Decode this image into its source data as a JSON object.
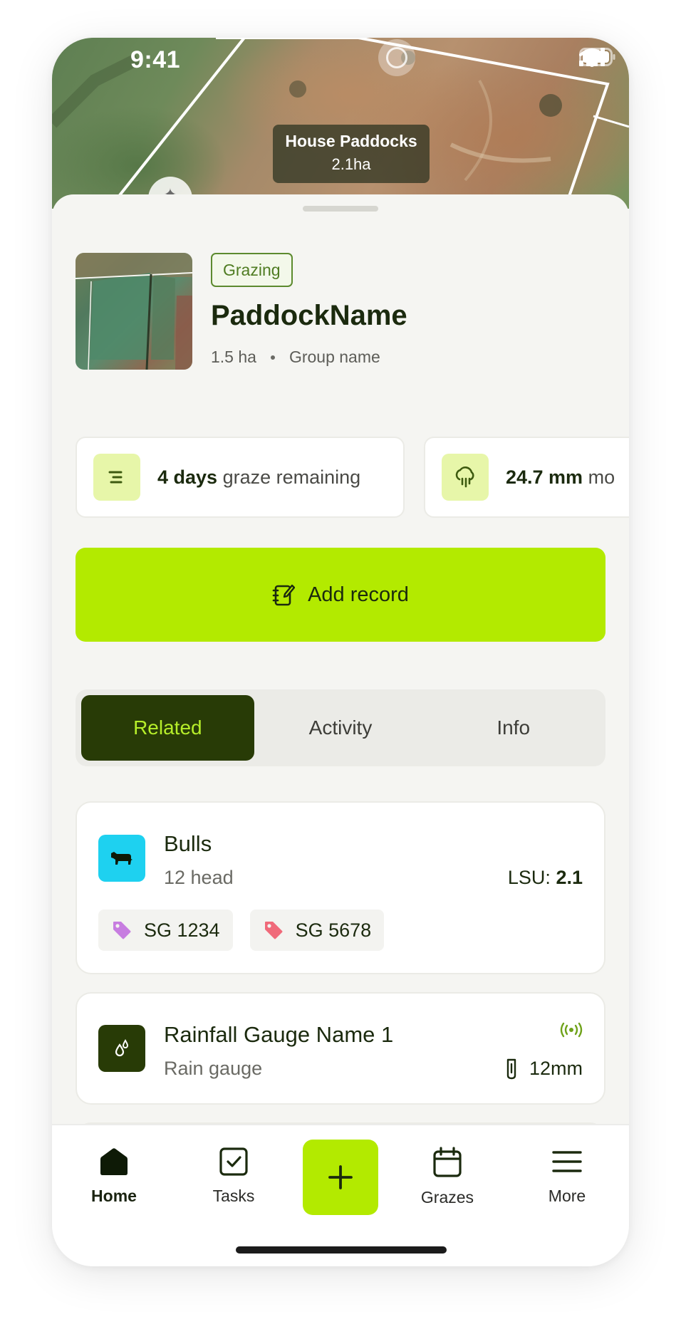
{
  "status_bar": {
    "time": "9:41"
  },
  "map": {
    "paddock_label": "House Paddocks",
    "paddock_area": "2.1ha"
  },
  "paddock": {
    "status": "Grazing",
    "name": "PaddockName",
    "area": "1.5 ha",
    "group": "Group name"
  },
  "stats": [
    {
      "value": "4 days",
      "label": "graze remaining",
      "icon": "graze-lines-icon"
    },
    {
      "value": "24.7 mm",
      "label": "mo",
      "icon": "rain-cloud-icon"
    }
  ],
  "add_record": {
    "label": "Add record",
    "icon": "notebook-edit-icon"
  },
  "tabs": [
    {
      "label": "Related",
      "active": true
    },
    {
      "label": "Activity",
      "active": false
    },
    {
      "label": "Info",
      "active": false
    }
  ],
  "related": {
    "mob": {
      "name": "Bulls",
      "count": "12 head",
      "lsu_label": "LSU:",
      "lsu_value": "2.1",
      "tags": [
        {
          "label": "SG 1234",
          "color": "#c77de0"
        },
        {
          "label": "SG 5678",
          "color": "#f06a7a"
        }
      ]
    },
    "gauge": {
      "name": "Rainfall Gauge Name 1",
      "type": "Rain gauge",
      "reading": "12mm"
    }
  },
  "nav": {
    "home": "Home",
    "tasks": "Tasks",
    "grazes": "Grazes",
    "more": "More"
  },
  "colors": {
    "accent": "#b3ea00",
    "dark_green": "#283b06",
    "cyan": "#1ed1f0"
  }
}
